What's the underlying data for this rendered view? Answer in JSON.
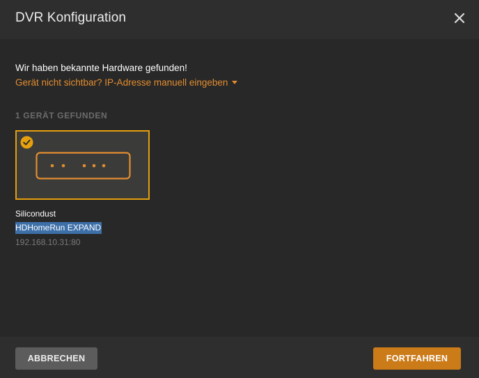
{
  "dialog": {
    "title": "DVR Konfiguration",
    "close_icon": "close-icon"
  },
  "content": {
    "found_text": "Wir haben bekannte Hardware gefunden!",
    "manual_link": "Gerät nicht sichtbar? IP-Adresse manuell eingeben",
    "section_label": "1 GERÄT GEFUNDEN"
  },
  "devices": [
    {
      "vendor": "Silicondust",
      "model": "HDHomeRun EXPAND",
      "ip": "192.168.10.31:80",
      "selected": true,
      "icon": "tuner-device-icon"
    }
  ],
  "footer": {
    "cancel_label": "ABBRECHEN",
    "continue_label": "FORTFAHREN"
  },
  "colors": {
    "accent": "#e5a00d",
    "link": "#e38d30",
    "primary_button": "#cc7b19",
    "secondary_button": "#5c5c5c",
    "selection_highlight": "#3d6fa8"
  }
}
